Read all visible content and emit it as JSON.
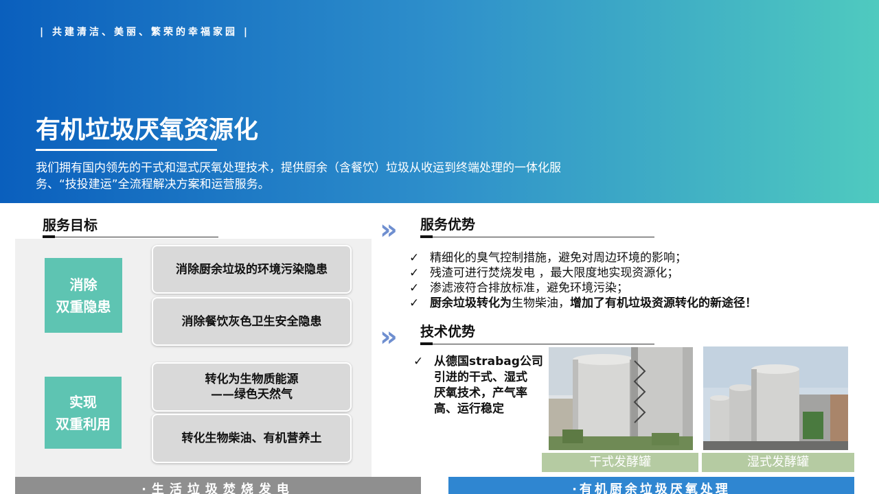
{
  "header": {
    "slogan": "| 共建清洁、美丽、繁荣的幸福家园 |",
    "title": "有机垃圾厌氧资源化",
    "description": "我们拥有国内领先的干式和湿式厌氧处理技术，提供厨余（含餐饮）垃圾从收运到终端处理的一体化服务、“技投建运”全流程解决方案和运营服务。"
  },
  "service_goals": {
    "heading": "服务目标",
    "group1": {
      "tag_line1": "消除",
      "tag_line2": "双重隐患",
      "item1": "消除厨余垃圾的环境污染隐患",
      "item2": "消除餐饮灰色卫生安全隐患"
    },
    "group2": {
      "tag_line1": "实现",
      "tag_line2": "双重利用",
      "item1_line1": "转化为生物质能源",
      "item1_line2": "——绿色天然气",
      "item2": "转化生物柴油、有机营养土"
    }
  },
  "service_advantages": {
    "heading": "服务优势",
    "check": "✓",
    "items": [
      "精细化的臭气控制措施，避免对周边环境的影响；",
      "残渣可进行焚烧发电 ，最大限度地实现资源化；",
      "渗滤液符合排放标准，避免环境污染；"
    ],
    "item4_part1": "厨余垃圾转化为",
    "item4_part2": "生物柴油，",
    "item4_part3": "增加了有机垃圾资源转化的新途径！"
  },
  "tech_advantages": {
    "heading": "技术优势",
    "lines": [
      "从德国strabag公司",
      "引进的干式、湿式",
      "厌氧技术，产气率",
      "高、运行稳定"
    ],
    "photo1_caption": "干式发酵罐",
    "photo2_caption": "湿式发酵罐"
  },
  "footer": {
    "left_tab": "·生活垃圾焚烧发电",
    "right_tab": "·有机厨余垃圾厌氧处理"
  },
  "colors": {
    "teal": "#5ec4b2",
    "hero_start": "#0a5fbd",
    "hero_end": "#4fcabf",
    "chevron": "#6f8fd0",
    "caption_bg": "#b5cba2"
  }
}
